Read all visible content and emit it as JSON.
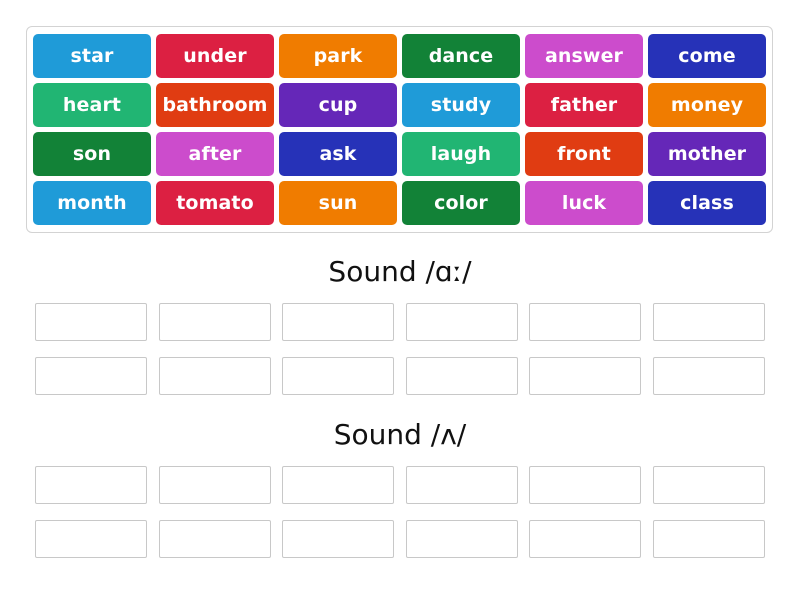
{
  "activity": {
    "type": "group-sort",
    "word_bank": {
      "rows": [
        [
          {
            "text": "star",
            "color": "#1f9bd8"
          },
          {
            "text": "under",
            "color": "#dc2042"
          },
          {
            "text": "park",
            "color": "#f07c00"
          },
          {
            "text": "dance",
            "color": "#128237"
          },
          {
            "text": "answer",
            "color": "#cc4ccc"
          },
          {
            "text": "come",
            "color": "#2632b8"
          }
        ],
        [
          {
            "text": "heart",
            "color": "#21b573"
          },
          {
            "text": "bathroom",
            "color": "#e03c12"
          },
          {
            "text": "cup",
            "color": "#6527b8"
          },
          {
            "text": "study",
            "color": "#1f9bd8"
          },
          {
            "text": "father",
            "color": "#dc2042"
          },
          {
            "text": "money",
            "color": "#f07c00"
          }
        ],
        [
          {
            "text": "son",
            "color": "#128237"
          },
          {
            "text": "after",
            "color": "#cc4ccc"
          },
          {
            "text": "ask",
            "color": "#2632b8"
          },
          {
            "text": "laugh",
            "color": "#21b573"
          },
          {
            "text": "front",
            "color": "#e03c12"
          },
          {
            "text": "mother",
            "color": "#6527b8"
          }
        ],
        [
          {
            "text": "month",
            "color": "#1f9bd8"
          },
          {
            "text": "tomato",
            "color": "#dc2042"
          },
          {
            "text": "sun",
            "color": "#f07c00"
          },
          {
            "text": "color",
            "color": "#128237"
          },
          {
            "text": "luck",
            "color": "#cc4ccc"
          },
          {
            "text": "class",
            "color": "#2632b8"
          }
        ]
      ]
    },
    "categories": [
      {
        "title": "Sound /ɑː/",
        "slots": [
          [
            "",
            "",
            "",
            "",
            "",
            ""
          ],
          [
            "",
            "",
            "",
            "",
            "",
            ""
          ]
        ]
      },
      {
        "title": "Sound /ʌ/",
        "slots": [
          [
            "",
            "",
            "",
            "",
            "",
            ""
          ],
          [
            "",
            "",
            "",
            "",
            "",
            ""
          ]
        ]
      }
    ]
  }
}
